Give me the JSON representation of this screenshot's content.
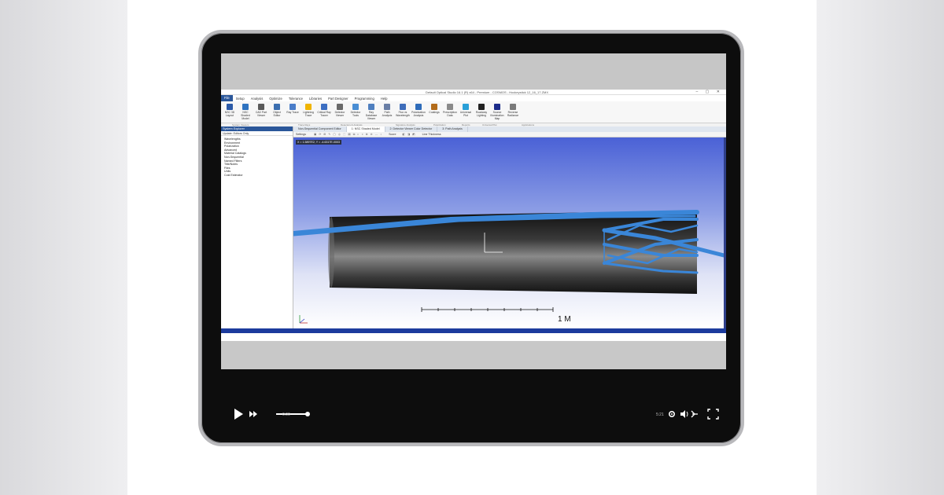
{
  "window": {
    "title": "Default Optical Studio 16.1 (R) x64 - Premium - COSMOS - Hockeystick 12_16_17.ZMX"
  },
  "menu": {
    "tabs": [
      "File",
      "Setup",
      "Analysis",
      "Optimize",
      "Tolerance",
      "Libraries",
      "Part Designer",
      "Programming",
      "Help"
    ]
  },
  "ribbon": {
    "buttons": [
      {
        "label": "NSC 3D Layout",
        "color": "#2b5aa8"
      },
      {
        "label": "NSC Shaded Model",
        "color": "#2f73c0"
      },
      {
        "label": "CAD Part Viewer",
        "color": "#5a5a5a"
      },
      {
        "label": "Object Editor",
        "color": "#3c6fb0"
      },
      {
        "label": "Ray Trace",
        "color": "#4a7dc9"
      },
      {
        "label": "Lightning Trace",
        "color": "#f0b400"
      },
      {
        "label": "Critical Ray Tracer",
        "color": "#3d6fc2"
      },
      {
        "label": "Detector Viewer",
        "color": "#6a6a6a"
      },
      {
        "label": "Detector Tools",
        "color": "#4a8ed4"
      },
      {
        "label": "Ray Database Viewer",
        "color": "#4f7fbf"
      },
      {
        "label": "Path Analysis",
        "color": "#6a7fa6"
      },
      {
        "label": "Flux vs Wavelength",
        "color": "#3e6dba"
      },
      {
        "label": "Polarization Analysis",
        "color": "#2e6cba"
      },
      {
        "label": "Coatings",
        "color": "#b36c1a"
      },
      {
        "label": "Prescription Data",
        "color": "#8a8a8a"
      },
      {
        "label": "Universal Plot",
        "color": "#2aa0d8"
      },
      {
        "label": "Roadway Lighting",
        "color": "#222222"
      },
      {
        "label": "Source Illumination Map",
        "color": "#1c2c8a"
      },
      {
        "label": "Reverse Radiance",
        "color": "#7a7a7a"
      }
    ],
    "groups": [
      "System Viewers",
      "Trace Rays",
      "Detectors & Analysis",
      "Signature Analysis",
      "Polarization",
      "Reports",
      "Universal Plot",
      "Applications"
    ]
  },
  "explorer": {
    "title": "System Explorer",
    "subtitle": "Update: Editors Only",
    "items": [
      "Wavelengths",
      "Environment",
      "Polarization",
      "Advanced",
      "Material Catalogs",
      "Non-Sequential",
      "Named Filters",
      "Title/Notes",
      "Files",
      "Units",
      "Cost Estimator"
    ]
  },
  "doc_tabs": [
    "Non-Sequential Component Editor",
    "1: NSC Shaded Model",
    "2: Detector Viewer Color Detector",
    "3: Path Analysis"
  ],
  "view_toolbar": {
    "left": "Settings",
    "score": "Score",
    "limit": "Line Thickness"
  },
  "viewport": {
    "coord": "X = 1.5897E2, Y = -4.6317E-0003",
    "scale": "1 M",
    "beam_color": "#3a86d8"
  },
  "player": {
    "elapsed": "0:00",
    "remaining": "5:21"
  }
}
